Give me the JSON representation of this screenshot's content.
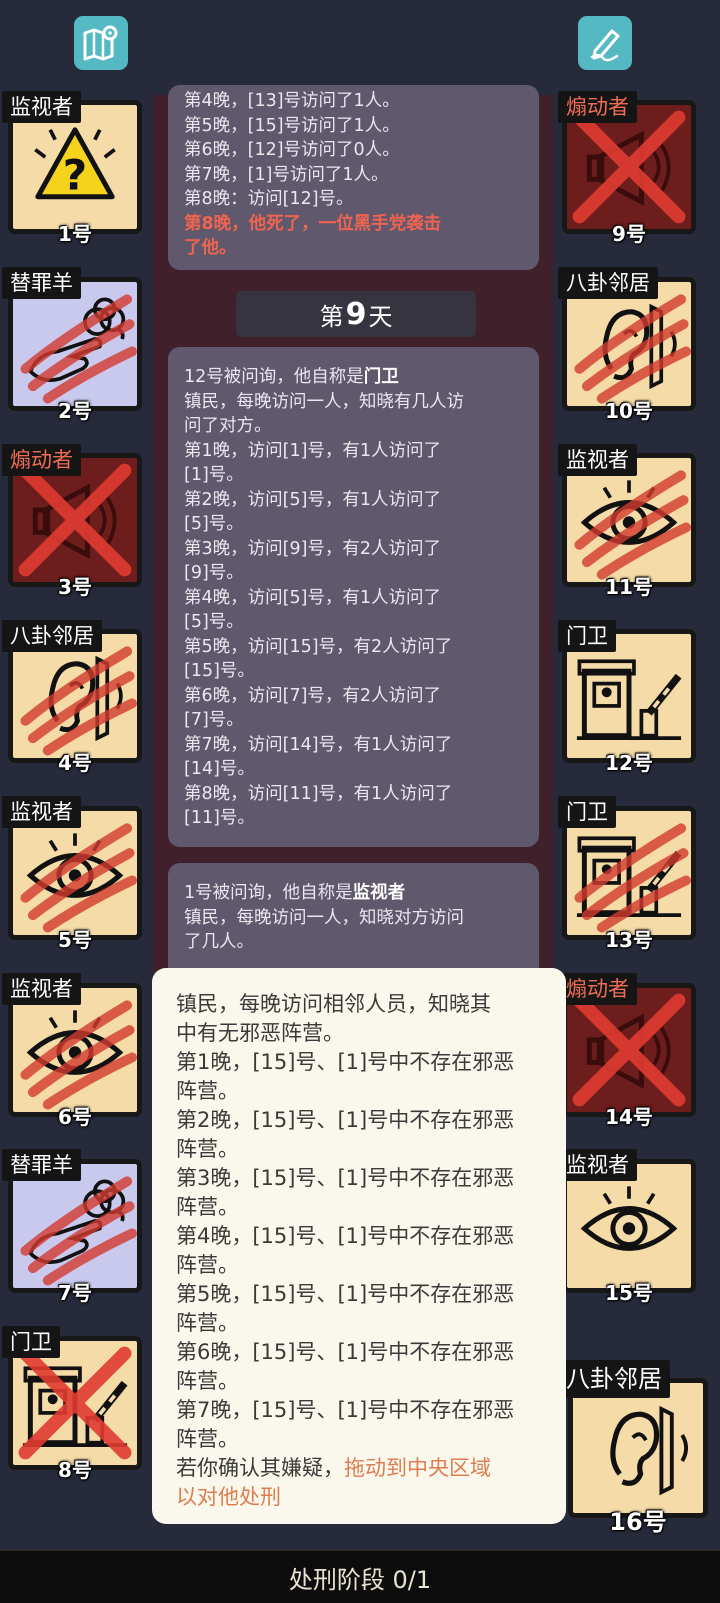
{
  "top_icons": {
    "map": "map-icon",
    "notes": "pencil-note-icon"
  },
  "players": [
    {
      "n": "1号",
      "role": "监视者",
      "icon": "warning-question-icon"
    },
    {
      "n": "2号",
      "role": "替罪羊",
      "icon": "pointing-hand-sheep-icon"
    },
    {
      "n": "3号",
      "role": "煽动者",
      "icon": "megaphone-icon"
    },
    {
      "n": "4号",
      "role": "八卦邻居",
      "icon": "ear-icon"
    },
    {
      "n": "5号",
      "role": "监视者",
      "icon": "eye-icon"
    },
    {
      "n": "6号",
      "role": "监视者",
      "icon": "eye-icon"
    },
    {
      "n": "7号",
      "role": "替罪羊",
      "icon": "pointing-hand-sheep-icon"
    },
    {
      "n": "8号",
      "role": "门卫",
      "icon": "guard-booth-icon"
    },
    {
      "n": "9号",
      "role": "煽动者",
      "icon": "megaphone-icon"
    },
    {
      "n": "10号",
      "role": "八卦邻居",
      "icon": "ear-icon"
    },
    {
      "n": "11号",
      "role": "监视者",
      "icon": "eye-icon"
    },
    {
      "n": "12号",
      "role": "门卫",
      "icon": "guard-booth-icon"
    },
    {
      "n": "13号",
      "role": "门卫",
      "icon": "guard-booth-icon"
    },
    {
      "n": "14号",
      "role": "煽动者",
      "icon": "megaphone-icon"
    },
    {
      "n": "15号",
      "role": "监视者",
      "icon": "eye-icon"
    },
    {
      "n": "16号",
      "role": "八卦邻居",
      "icon": "ear-icon"
    }
  ],
  "log": {
    "msg1": [
      "第4晚，[13]号访问了1人。",
      "第5晚，[15]号访问了1人。",
      "第6晚，[12]号访问了0人。",
      "第7晚，[1]号访问了1人。",
      "第8晚：访问[12]号。"
    ],
    "msg1_death": [
      "第8晚，他死了，一位黑手党袭击",
      "了他。"
    ],
    "day_prefix": "第",
    "day_num": "9",
    "day_suffix": "天",
    "msg2_head": "12号被问询，他自称是",
    "msg2_role": "门卫",
    "msg2_lines": [
      "镇民，每晚访问一人，知晓有几人访",
      "问了对方。",
      "第1晚，访问[1]号，有1人访问了",
      "[1]号。",
      "第2晚，访问[5]号，有1人访问了",
      "[5]号。",
      "第3晚，访问[9]号，有2人访问了",
      "[9]号。",
      "第4晚，访问[5]号，有1人访问了",
      "[5]号。",
      "第5晚，访问[15]号，有2人访问了",
      "[15]号。",
      "第6晚，访问[7]号，有2人访问了",
      "[7]号。",
      "第7晚，访问[14]号，有1人访问了",
      "[14]号。",
      "第8晚，访问[11]号，有1人访问了",
      "[11]号。"
    ],
    "msg3_head": "1号被问询，他自称是",
    "msg3_role": "监视者",
    "msg3_lines": [
      "镇民，每晚访问一人，知晓对方访问",
      "了几人。"
    ]
  },
  "tooltip": {
    "lines": [
      "镇民，每晚访问相邻人员，知晓其",
      "中有无邪恶阵营。",
      "第1晚，[15]号、[1]号中不存在邪恶",
      "阵营。",
      "第2晚，[15]号、[1]号中不存在邪恶",
      "阵营。",
      "第3晚，[15]号、[1]号中不存在邪恶",
      "阵营。",
      "第4晚，[15]号、[1]号中不存在邪恶",
      "阵营。",
      "第5晚，[15]号、[1]号中不存在邪恶",
      "阵营。",
      "第6晚，[15]号、[1]号中不存在邪恶",
      "阵营。",
      "第7晚，[15]号、[1]号中不存在邪恶",
      "阵营。"
    ],
    "hint_prefix": "若你确认其嫌疑，",
    "hint_action1": "拖动到中央区域",
    "hint_action2": "以对他处刑"
  },
  "bottom_bar": {
    "label": "处刑阶段 0/1"
  }
}
